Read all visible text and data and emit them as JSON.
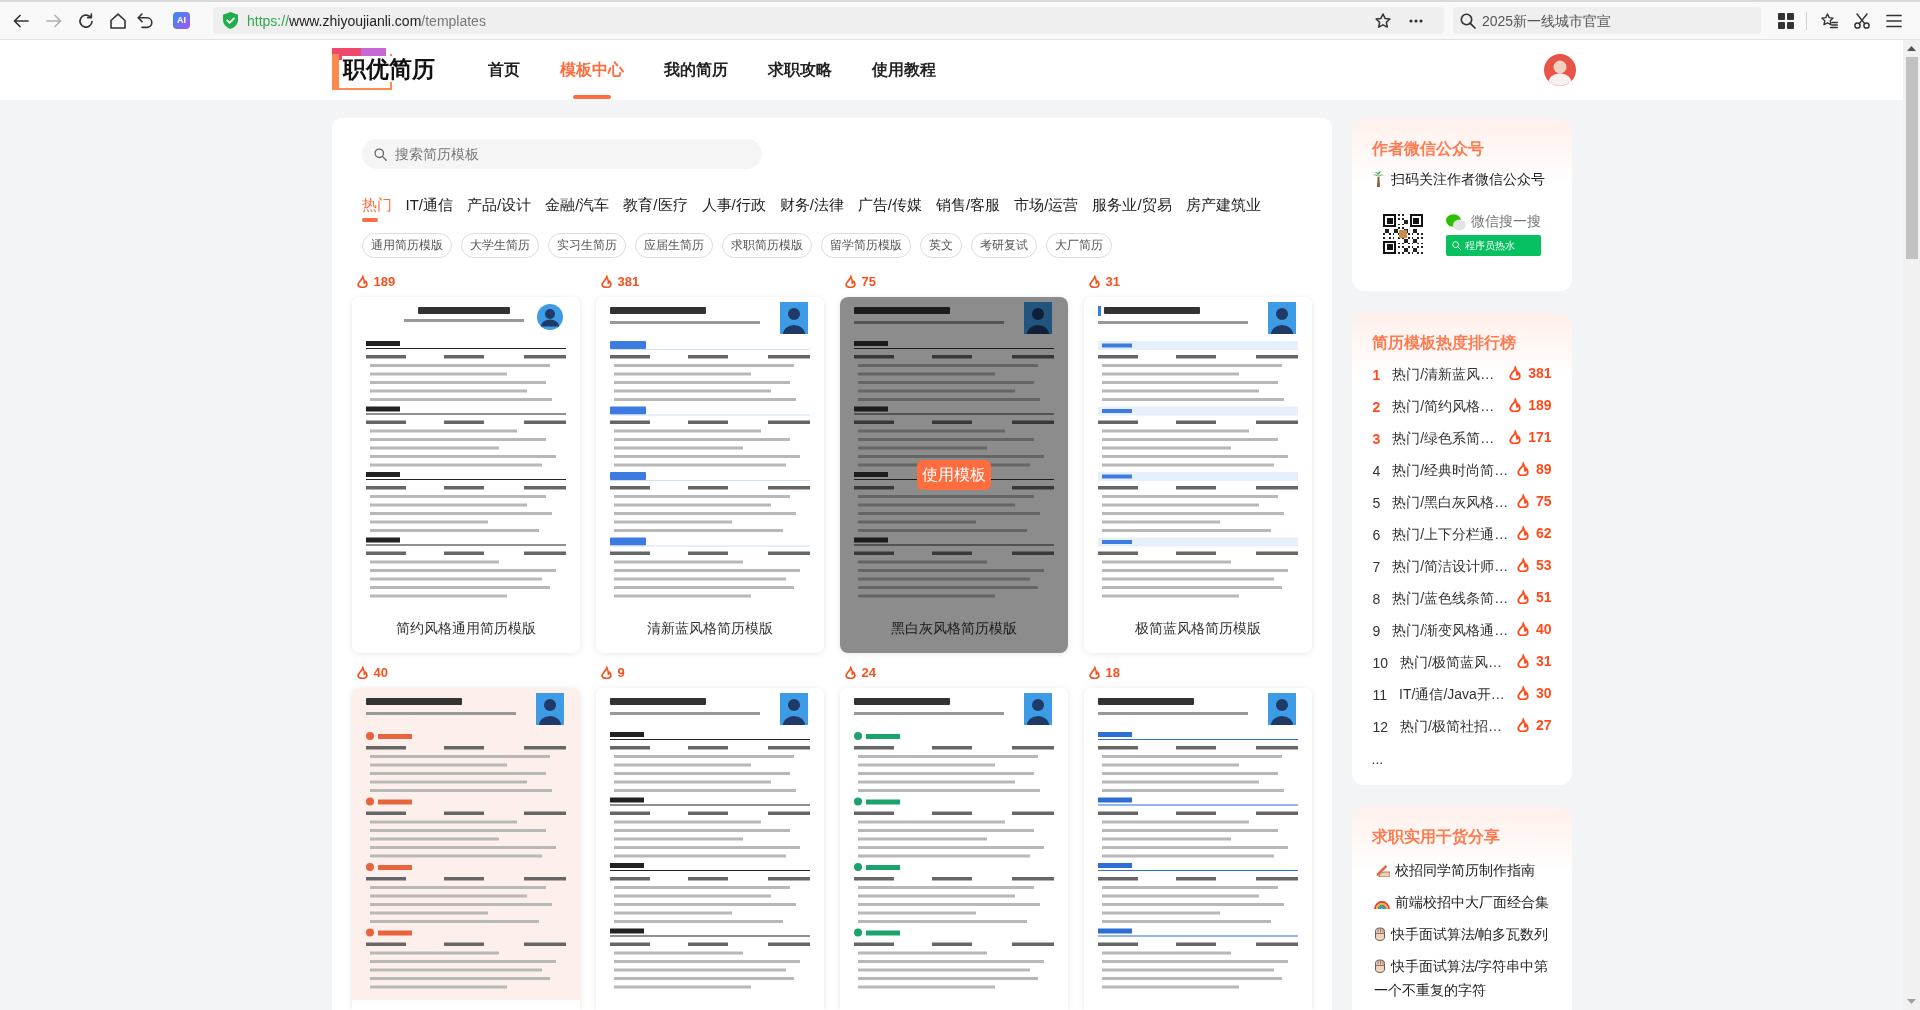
{
  "browser": {
    "forward_disabled": true,
    "ai_label": "AI",
    "url": {
      "scheme": "https://",
      "host": "www.zhiyoujianli.com",
      "path": "/templates"
    },
    "search": {
      "placeholder": "2025新一线城市官宣"
    }
  },
  "site_header": {
    "logo": "职优简历",
    "nav": [
      {
        "label": "首页",
        "selected": false
      },
      {
        "label": "模板中心",
        "selected": true
      },
      {
        "label": "我的简历",
        "selected": false
      },
      {
        "label": "求职攻略",
        "selected": false
      },
      {
        "label": "使用教程",
        "selected": false
      }
    ]
  },
  "template_panel": {
    "search": {
      "placeholder": "搜索简历模板"
    },
    "categories": [
      {
        "label": "热门",
        "selected": true
      },
      {
        "label": "IT/通信",
        "selected": false
      },
      {
        "label": "产品/设计",
        "selected": false
      },
      {
        "label": "金融/汽车",
        "selected": false
      },
      {
        "label": "教育/医疗",
        "selected": false
      },
      {
        "label": "人事/行政",
        "selected": false
      },
      {
        "label": "财务/法律",
        "selected": false
      },
      {
        "label": "广告/传媒",
        "selected": false
      },
      {
        "label": "销售/客服",
        "selected": false
      },
      {
        "label": "市场/运营",
        "selected": false
      },
      {
        "label": "服务业/贸易",
        "selected": false
      },
      {
        "label": "房产建筑业",
        "selected": false
      }
    ],
    "tags": [
      "通用简历模版",
      "大学生简历",
      "实习生简历",
      "应届生简历",
      "求职简历模版",
      "留学简历模版",
      "英文",
      "考研复试",
      "大厂简历"
    ],
    "hover_button": "使用模板",
    "templates": [
      {
        "count": "189",
        "title": "简约风格通用简历模版",
        "kind": "classic",
        "hovered": false
      },
      {
        "count": "381",
        "title": "清新蓝风格简历模版",
        "kind": "fresh",
        "hovered": false
      },
      {
        "count": "75",
        "title": "黑白灰风格简历模版",
        "kind": "mono",
        "hovered": true
      },
      {
        "count": "31",
        "title": "极简蓝风格简历模版",
        "kind": "minimal",
        "hovered": false
      },
      {
        "count": "40",
        "kind": "warm",
        "hovered": false
      },
      {
        "count": "9",
        "kind": "plain",
        "hovered": false
      },
      {
        "count": "24",
        "kind": "green",
        "hovered": false
      },
      {
        "count": "18",
        "kind": "lined",
        "hovered": false
      }
    ]
  },
  "sidebar": {
    "wechat_card": {
      "title": "作者微信公众号",
      "subtitle": "扫码关注作者微信公众号",
      "search_label": "微信搜一搜",
      "search_button": "程序员热水"
    },
    "ranking": {
      "title": "简历模板热度排行榜",
      "items": [
        {
          "rank": "1",
          "title": "热门/清新蓝风…",
          "count": "381",
          "highlighted": true
        },
        {
          "rank": "2",
          "title": "热门/简约风格…",
          "count": "189",
          "highlighted": true
        },
        {
          "rank": "3",
          "title": "热门/绿色系简…",
          "count": "171",
          "highlighted": true
        },
        {
          "rank": "4",
          "title": "热门/经典时尚简…",
          "count": "89",
          "highlighted": false
        },
        {
          "rank": "5",
          "title": "热门/黑白灰风格…",
          "count": "75",
          "highlighted": false
        },
        {
          "rank": "6",
          "title": "热门/上下分栏通…",
          "count": "62",
          "highlighted": false
        },
        {
          "rank": "7",
          "title": "热门/简洁设计师…",
          "count": "53",
          "highlighted": false
        },
        {
          "rank": "8",
          "title": "热门/蓝色线条简…",
          "count": "51",
          "highlighted": false
        },
        {
          "rank": "9",
          "title": "热门/渐变风格通…",
          "count": "40",
          "highlighted": false
        },
        {
          "rank": "10",
          "title": "热门/极简蓝风…",
          "count": "31",
          "highlighted": false
        },
        {
          "rank": "11",
          "title": "IT/通信/Java开…",
          "count": "30",
          "highlighted": false
        },
        {
          "rank": "12",
          "title": "热门/极简社招…",
          "count": "27",
          "highlighted": false
        }
      ],
      "more": "..."
    },
    "articles": {
      "title": "求职实用干货分享",
      "items": [
        {
          "kind": "guide",
          "title": "校招同学简历制作指南"
        },
        {
          "kind": "collection",
          "title": "前端校招中大厂面经合集"
        },
        {
          "kind": "algorithm",
          "title": "快手面试算法/帕多瓦数列"
        },
        {
          "kind": "algorithm",
          "title": "快手面试算法/字符串中第一个不重复的字符"
        }
      ]
    }
  }
}
